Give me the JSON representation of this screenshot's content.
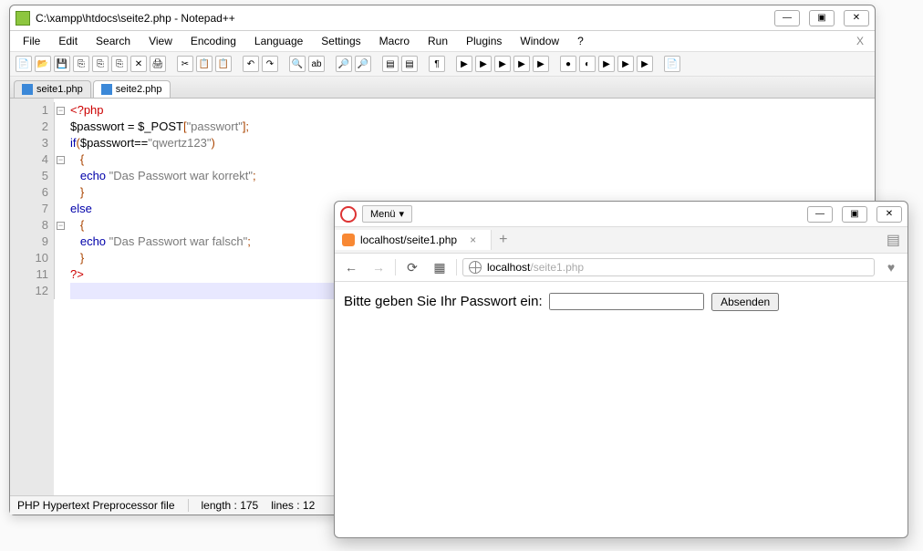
{
  "npp": {
    "title": "C:\\xampp\\htdocs\\seite2.php - Notepad++",
    "window_controls": {
      "min": "—",
      "max": "▣",
      "close": "✕"
    },
    "menus": [
      "File",
      "Edit",
      "Search",
      "View",
      "Encoding",
      "Language",
      "Settings",
      "Macro",
      "Run",
      "Plugins",
      "Window",
      "?"
    ],
    "tabs": [
      {
        "label": "seite1.php",
        "active": false
      },
      {
        "label": "seite2.php",
        "active": true
      }
    ],
    "gutter_lines": [
      "1",
      "2",
      "3",
      "4",
      "5",
      "6",
      "7",
      "8",
      "9",
      "10",
      "11",
      "12"
    ],
    "code_tokens": [
      [
        {
          "t": "<?",
          "c": "tok-tag"
        },
        {
          "t": "php",
          "c": "tok-tag"
        }
      ],
      [
        {
          "t": "$passwort",
          "c": "tok-var"
        },
        {
          "t": " = ",
          "c": ""
        },
        {
          "t": "$_POST",
          "c": "tok-var"
        },
        {
          "t": "[",
          "c": "tok-punc"
        },
        {
          "t": "\"passwort\"",
          "c": "tok-gray"
        },
        {
          "t": "];",
          "c": "tok-punc"
        }
      ],
      [
        {
          "t": "if",
          "c": "tok-key"
        },
        {
          "t": "(",
          "c": "tok-punc"
        },
        {
          "t": "$passwort",
          "c": "tok-var"
        },
        {
          "t": "==",
          "c": "tok-op"
        },
        {
          "t": "\"qwertz123\"",
          "c": "tok-gray"
        },
        {
          "t": ")",
          "c": "tok-punc"
        }
      ],
      [
        {
          "t": "   {",
          "c": "tok-punc"
        }
      ],
      [
        {
          "t": "   ",
          "c": ""
        },
        {
          "t": "echo",
          "c": "tok-key"
        },
        {
          "t": " ",
          "c": ""
        },
        {
          "t": "\"Das Passwort war korrekt\"",
          "c": "tok-gray"
        },
        {
          "t": ";",
          "c": "tok-punc"
        }
      ],
      [
        {
          "t": "   }",
          "c": "tok-punc"
        }
      ],
      [
        {
          "t": "else",
          "c": "tok-key"
        }
      ],
      [
        {
          "t": "   {",
          "c": "tok-punc"
        }
      ],
      [
        {
          "t": "   ",
          "c": ""
        },
        {
          "t": "echo",
          "c": "tok-key"
        },
        {
          "t": " ",
          "c": ""
        },
        {
          "t": "\"Das Passwort war falsch\"",
          "c": "tok-gray"
        },
        {
          "t": ";",
          "c": "tok-punc"
        }
      ],
      [
        {
          "t": "   }",
          "c": "tok-punc"
        }
      ],
      [
        {
          "t": "?>",
          "c": "tok-tag"
        }
      ],
      [
        {
          "t": "",
          "c": ""
        }
      ]
    ],
    "status": {
      "lang": "PHP Hypertext Preprocessor file",
      "length": "length : 175",
      "lines": "lines : 12"
    }
  },
  "browser": {
    "menu_label": "Menü",
    "tab_label": "localhost/seite1.php",
    "url_host": "localhost",
    "url_path": "/seite1.php",
    "page": {
      "prompt": "Bitte geben Sie Ihr Passwort ein:",
      "submit": "Absenden"
    },
    "window_controls": {
      "min": "—",
      "max": "▣",
      "close": "✕"
    }
  }
}
